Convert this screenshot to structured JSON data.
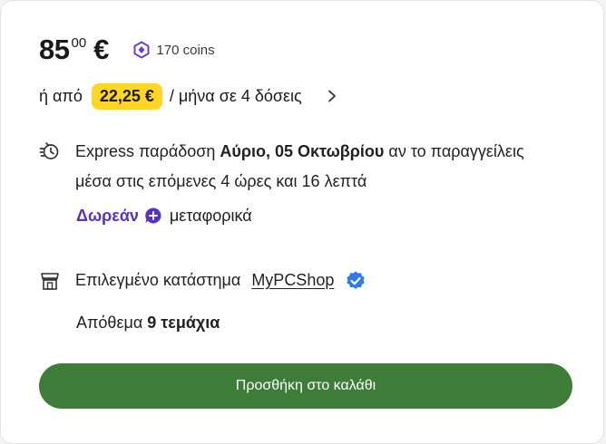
{
  "price": {
    "integer": "85",
    "decimals": "00",
    "currency": "€"
  },
  "coins": {
    "icon": "coin-hexagon-icon",
    "text": "170 coins",
    "color": "#6b3fd4"
  },
  "installments": {
    "prefix": "ή από",
    "amount": "22,25 €",
    "suffix": "/ μήνα σε 4 δόσεις",
    "badge_color": "#ffd626"
  },
  "delivery": {
    "icon": "express-clock-icon",
    "text_before": "Express παράδοση ",
    "date_bold": "Αύριο, 05 Οκτωβρίου",
    "text_after": " αν το παραγγείλεις",
    "line2": "μέσα στις επόμενες 4 ώρες και 16 λεπτά"
  },
  "shipping": {
    "free_label": "Δωρεάν",
    "rest": "μεταφορικά",
    "icon": "plus-badge-icon",
    "color": "#5b2fc6"
  },
  "store": {
    "icon": "store-icon",
    "label": "Επιλεγμένο κατάστημα",
    "name": "MyPCShop",
    "verified_icon": "verified-check-icon",
    "verified_color": "#2f7ae5"
  },
  "stock": {
    "label": "Απόθεμα ",
    "value": "9 τεμάχια"
  },
  "cart_button": {
    "label": "Προσθήκη στο καλάθι",
    "color": "#3e7c3a"
  }
}
